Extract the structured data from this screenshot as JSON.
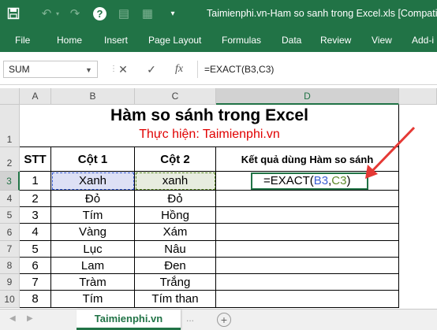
{
  "window": {
    "title": "Taimienphi.vn-Ham so sanh trong Excel.xls  [Compatibility"
  },
  "qat": {
    "save_icon": "save-icon",
    "undo_icon": "undo-icon",
    "redo_icon": "redo-icon",
    "help_label": "?"
  },
  "ribbon": {
    "tabs": [
      "File",
      "Home",
      "Insert",
      "Page Layout",
      "Formulas",
      "Data",
      "Review",
      "View",
      "Add-i"
    ]
  },
  "formula_bar": {
    "name_box": "SUM",
    "cancel": "✕",
    "enter": "✓",
    "fx": "fx",
    "formula": "=EXACT(B3,C3)"
  },
  "grid": {
    "columns": [
      "A",
      "B",
      "C",
      "D"
    ],
    "rows": [
      "1",
      "2",
      "3",
      "4",
      "5",
      "6",
      "7",
      "8",
      "9",
      "10"
    ],
    "title": "Hàm so sánh trong Excel",
    "subtitle": "Thực hiện: Taimienphi.vn",
    "headers": [
      "STT",
      "Cột 1",
      "Cột 2",
      "Kết quả dùng Hàm so sánh"
    ],
    "data": [
      [
        "1",
        "Xanh",
        "xanh"
      ],
      [
        "2",
        "Đỏ",
        "Đỏ"
      ],
      [
        "3",
        "Tím",
        "Hồng"
      ],
      [
        "4",
        "Vàng",
        "Xám"
      ],
      [
        "5",
        "Lục",
        "Nâu"
      ],
      [
        "6",
        "Lam",
        "Đen"
      ],
      [
        "7",
        "Tràm",
        "Trắng"
      ],
      [
        "8",
        "Tím",
        "Tím than"
      ]
    ],
    "editing": {
      "fn": "=EXACT(",
      "ref1": "B3",
      "comma": ",",
      "ref2": "C3",
      "close": ")"
    }
  },
  "sheets": {
    "active": "Taimienphi.vn",
    "more": "...",
    "add": "+"
  },
  "colors": {
    "accent": "#217346",
    "arrow": "#e53935",
    "subtitle": "#e00000"
  }
}
